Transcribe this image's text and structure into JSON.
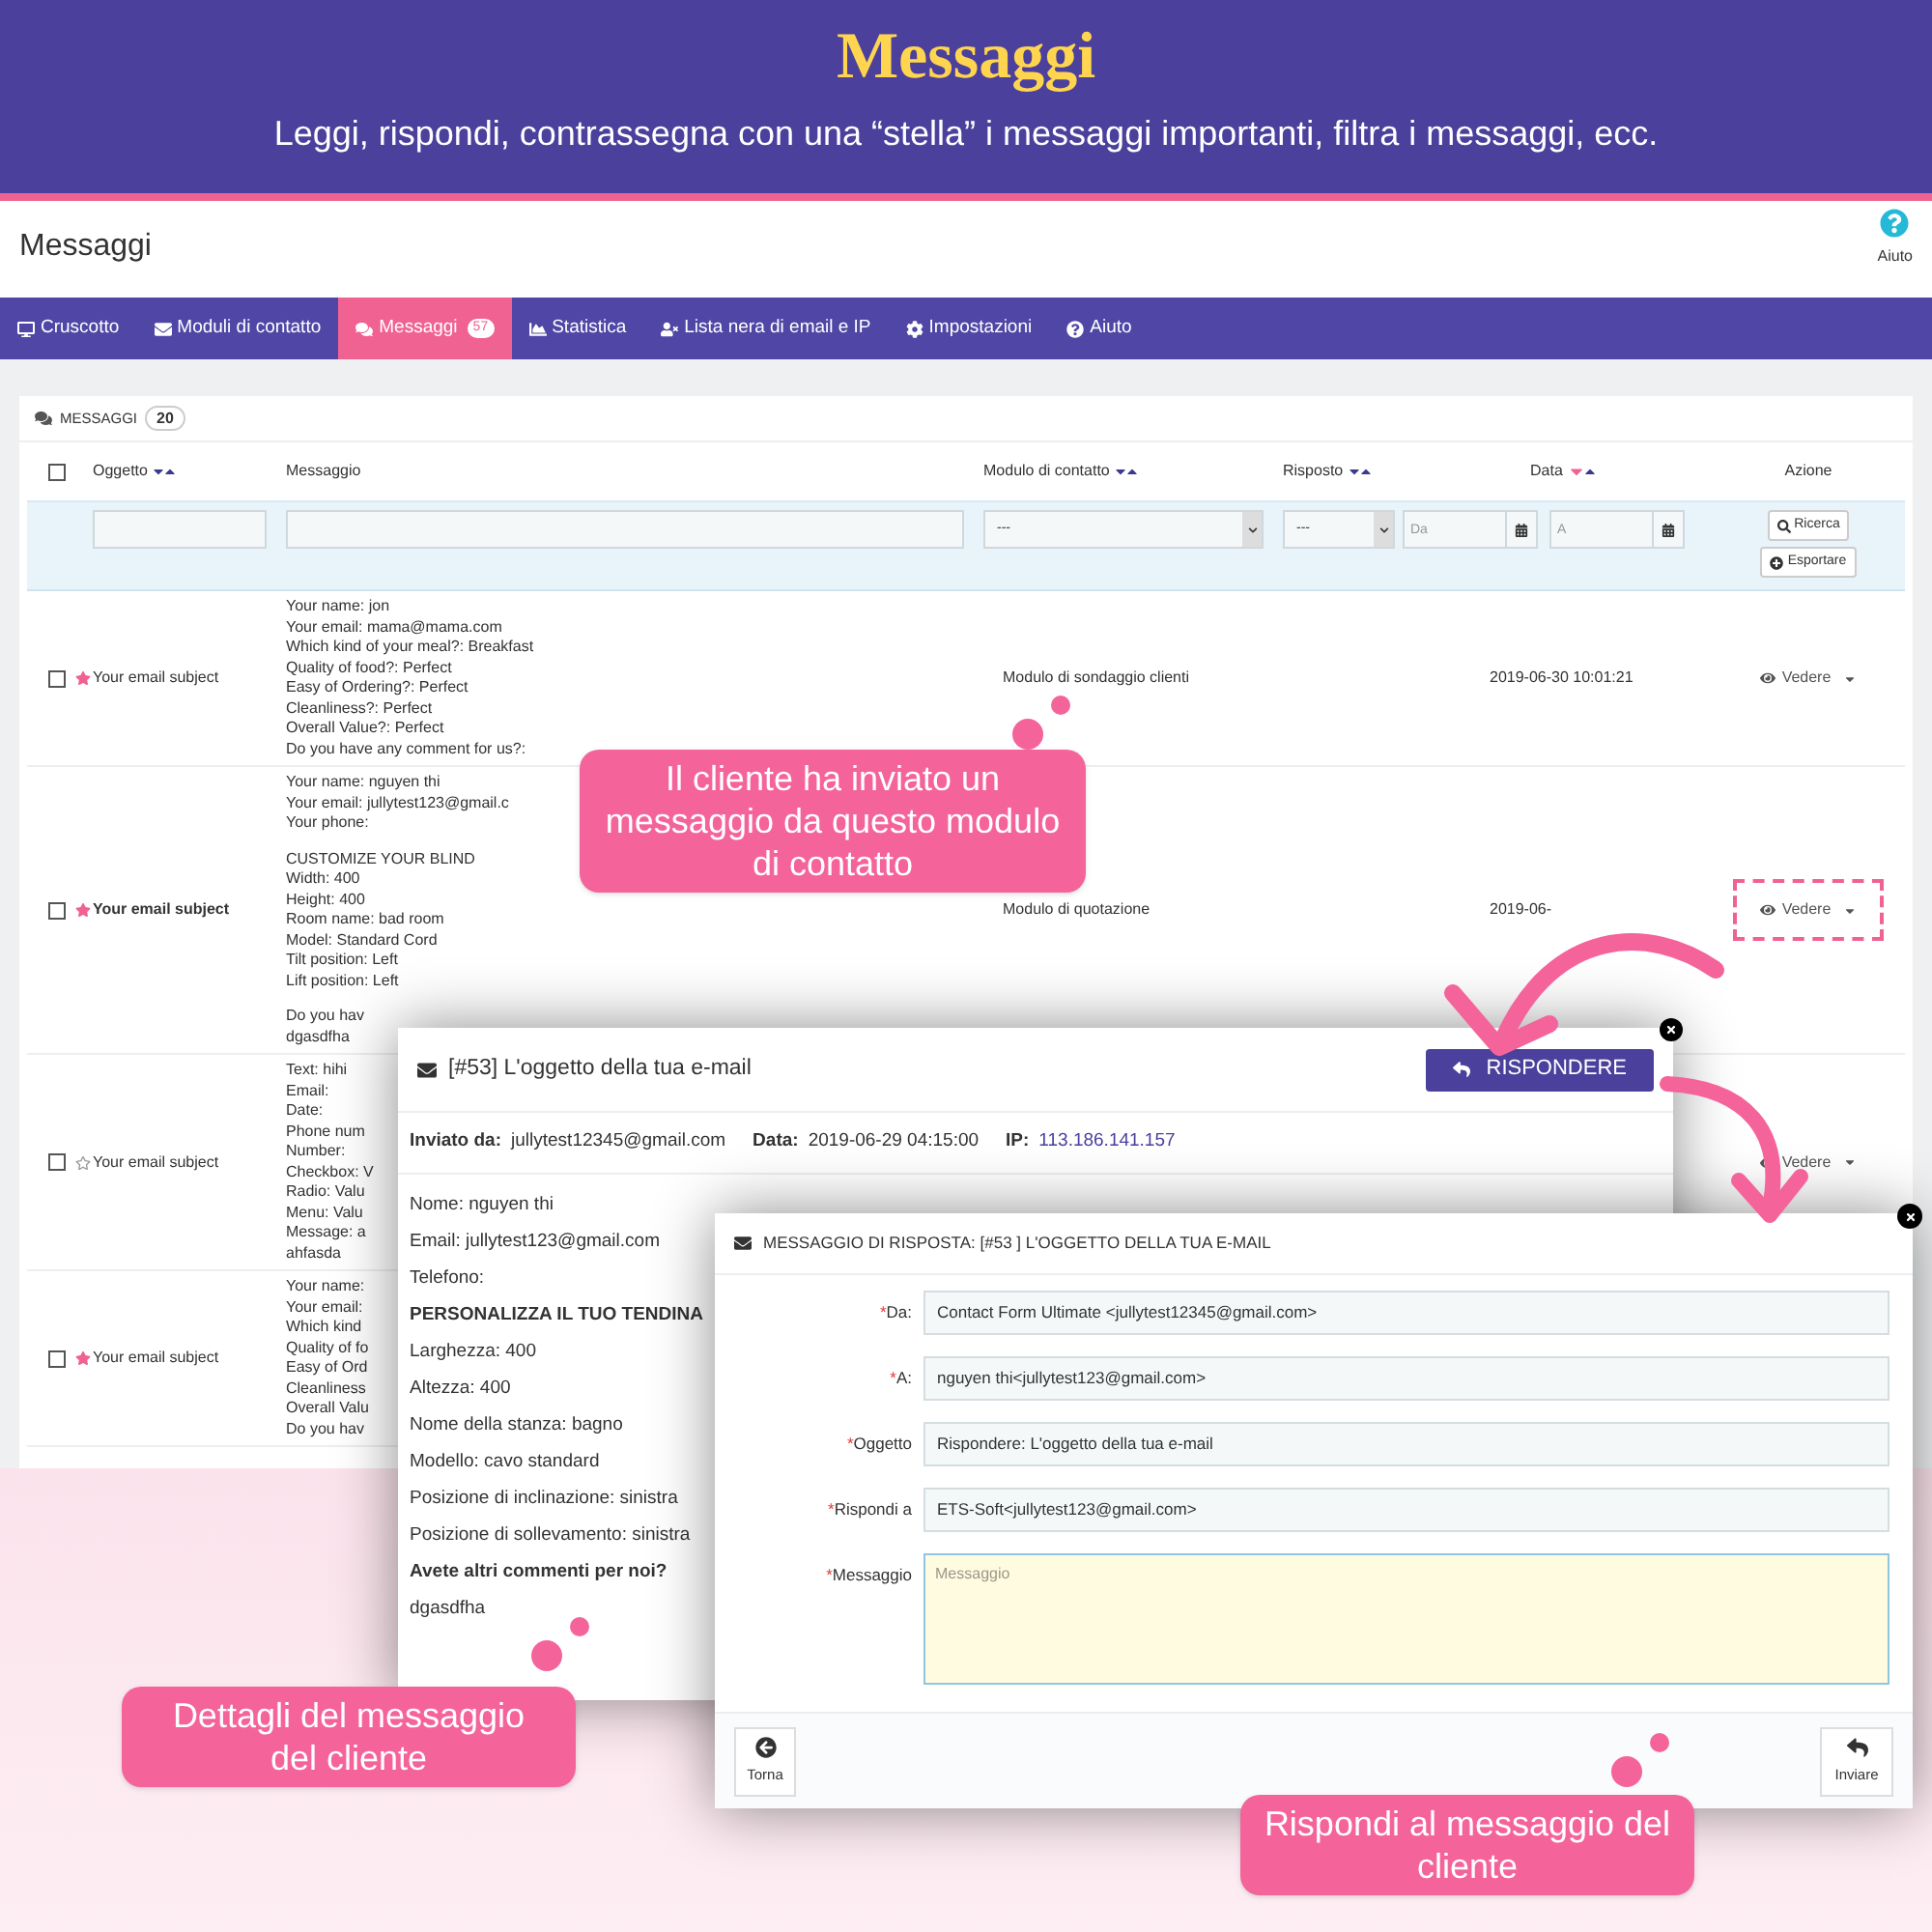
{
  "banner": {
    "title": "Messaggi",
    "subtitle": "Leggi, rispondi, contrassegna con una “stella” i messaggi importanti, filtra i messaggi, ecc."
  },
  "page": {
    "title": "Messaggi",
    "help_label": "Aiuto"
  },
  "nav": [
    {
      "label": "Cruscotto",
      "selected": false
    },
    {
      "label": "Moduli di contatto",
      "selected": false
    },
    {
      "label": "Messaggi",
      "selected": true,
      "badge": "57"
    },
    {
      "label": "Statistica",
      "selected": false
    },
    {
      "label": "Lista nera di email e IP",
      "selected": false
    },
    {
      "label": "Impostazioni",
      "selected": false
    },
    {
      "label": "Aiuto",
      "selected": false
    }
  ],
  "panel": {
    "title": "MESSAGGI",
    "count": "20"
  },
  "table": {
    "select_all_checked": false,
    "columns": [
      {
        "label": "Oggetto",
        "sortable": true,
        "sorted": false
      },
      {
        "label": "Messaggio"
      },
      {
        "label": "Modulo di contatto",
        "sortable": true,
        "sorted": false
      },
      {
        "label": "Risposto",
        "sortable": true,
        "sorted": false
      },
      {
        "label": "Data",
        "sortable": true,
        "sorted": true
      },
      {
        "label": "Azione"
      }
    ],
    "filters": {
      "form_select": "---",
      "replied_select": "---",
      "date_from_placeholder": "Da",
      "date_to_placeholder": "A",
      "search_button": "Ricerca",
      "export_button": "Esportare"
    },
    "rows": [
      {
        "subject": "Your email subject",
        "checked": false,
        "starred": true,
        "unread": false,
        "message": [
          [
            "Your name: jon",
            "Your email: mama@mama.com",
            "Which kind of your meal?: Breakfast",
            "Quality of food?: Perfect",
            "Easy of Ordering?: Perfect",
            "Cleanliness?: Perfect",
            "Overall Value?: Perfect",
            "Do you have any comment for us?:"
          ]
        ],
        "form": "Modulo di sondaggio clienti",
        "date": "2019-06-30 10:01:21",
        "action": "Vedere"
      },
      {
        "subject": "Your email subject",
        "checked": false,
        "starred": true,
        "unread": true,
        "highlighted": true,
        "message": [
          [
            "Your name: nguyen thi",
            "Your email: jullytest123@gmail.c",
            "Your phone:"
          ],
          [
            "CUSTOMIZE YOUR BLIND",
            "Width: 400",
            "Height: 400",
            "Room name: bad room",
            "Model: Standard Cord",
            "Tilt position: Left",
            "Lift position: Left"
          ],
          [
            "Do you hav",
            "dgasdfha"
          ]
        ],
        "form": "Modulo di quotazione",
        "date": "2019-06-",
        "action": "Vedere"
      },
      {
        "subject": "Your email subject",
        "checked": false,
        "starred": false,
        "unread": false,
        "message": [
          [
            "Text: hihi",
            "Email:",
            "Date:",
            "Phone num",
            "Number:",
            "Checkbox: V",
            "Radio: Valu",
            "Menu: Valu",
            "Message: a",
            "ahfasda"
          ]
        ],
        "action": "Vedere"
      },
      {
        "subject": "Your email subject",
        "checked": false,
        "starred": true,
        "unread": false,
        "message": [
          [
            "Your name:",
            "Your email:",
            "Which kind",
            "Quality of fo",
            "Easy of Ord",
            "Cleanliness",
            "Overall Valu",
            "Do you hav"
          ]
        ]
      }
    ]
  },
  "message_modal": {
    "title": "[#53] L'oggetto della tua e-mail",
    "reply_button": "RISPONDERE",
    "info": [
      {
        "label": "Inviato da:",
        "value": "jullytest12345@gmail.com",
        "link": false
      },
      {
        "label": "Data:",
        "value": "2019-06-29 04:15:00",
        "link": false
      },
      {
        "label": "IP:",
        "value": "113.186.141.157",
        "link": true
      }
    ],
    "lines": [
      {
        "text": "Nome: nguyen thi",
        "bold": false
      },
      {
        "text": "Email: jullytest123@gmail.com",
        "bold": false
      },
      {
        "text": "Telefono:",
        "bold": false
      },
      {
        "text": "PERSONALIZZA IL TUO TENDINA",
        "bold": true
      },
      {
        "text": "Larghezza: 400",
        "bold": false
      },
      {
        "text": "Altezza: 400",
        "bold": false
      },
      {
        "text": "Nome della stanza: bagno",
        "bold": false
      },
      {
        "text": "Modello: cavo standard",
        "bold": false
      },
      {
        "text": "Posizione di inclinazione: sinistra",
        "bold": false
      },
      {
        "text": "Posizione di sollevamento: sinistra",
        "bold": false
      },
      {
        "text": "Avete altri commenti per noi?",
        "bold": true
      },
      {
        "text": "dgasdfha",
        "bold": false
      }
    ]
  },
  "reply_modal": {
    "required_mark": "*",
    "title": "MESSAGGIO DI RISPOSTA: [#53 ] L'OGGETTO DELLA TUA E-MAIL",
    "fields": [
      {
        "label": "Da:",
        "required": true,
        "kind": "input",
        "value": "Contact Form Ultimate <jullytest12345@gmail.com>"
      },
      {
        "label": "A:",
        "required": true,
        "kind": "input",
        "value": "nguyen thi<jullytest123@gmail.com>"
      },
      {
        "label": "Oggetto",
        "required": true,
        "kind": "input",
        "value": "Rispondere: L'oggetto della tua e-mail"
      },
      {
        "label": "Rispondi a",
        "required": true,
        "kind": "input",
        "value": "ETS-Soft<jullytest123@gmail.com>"
      },
      {
        "label": "Messaggio",
        "required": true,
        "kind": "textarea",
        "placeholder": "Messaggio"
      }
    ],
    "back_button": "Torna",
    "send_button": "Inviare"
  },
  "callouts": [
    {
      "text": "Il cliente ha inviato un messaggio da questo modulo di contatto"
    },
    {
      "text": "Dettagli del messaggio del cliente"
    },
    {
      "text": "Rispondi al messaggio del cliente"
    }
  ]
}
